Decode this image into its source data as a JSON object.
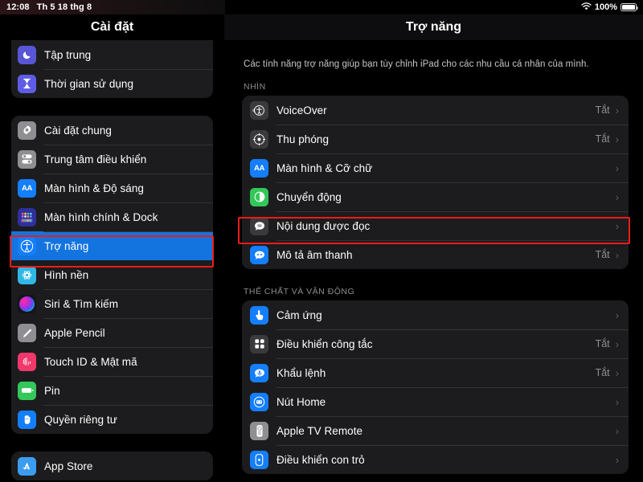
{
  "status_bar": {
    "time": "12:08",
    "date": "Th 5 18 thg 8",
    "wifi_icon": "wifi-icon",
    "battery_percent": "100%",
    "battery_icon": "battery-full-icon"
  },
  "sidebar": {
    "title": "Cài đặt",
    "groups": [
      {
        "items": [
          {
            "label": "Tập trung",
            "icon": "moon-icon",
            "color": "#5856d6"
          },
          {
            "label": "Thời gian sử dụng",
            "icon": "hourglass-icon",
            "color": "#5e5ce6"
          }
        ]
      },
      {
        "items": [
          {
            "label": "Cài đặt chung",
            "icon": "gear-icon",
            "color": "#8e8e93"
          },
          {
            "label": "Trung tâm điều khiển",
            "icon": "toggles-icon",
            "color": "#8e8e93"
          },
          {
            "label": "Màn hình & Độ sáng",
            "icon": "aa-icon",
            "color": "#147efb"
          },
          {
            "label": "Màn hình chính & Dock",
            "icon": "home-grid-icon",
            "color": "#3b3bb5"
          },
          {
            "label": "Trợ năng",
            "icon": "accessibility-icon",
            "color": "#147efb",
            "selected": true
          },
          {
            "label": "Hình nền",
            "icon": "wallpaper-icon",
            "color": "#2fb8e6"
          },
          {
            "label": "Siri & Tìm kiếm",
            "icon": "siri-icon",
            "color": "#1c1c1e"
          },
          {
            "label": "Apple Pencil",
            "icon": "pencil-icon",
            "color": "#8e8e93"
          },
          {
            "label": "Touch ID & Mật mã",
            "icon": "fingerprint-icon",
            "color": "#f0386b"
          },
          {
            "label": "Pin",
            "icon": "battery-icon",
            "color": "#34c759"
          },
          {
            "label": "Quyền riêng tư",
            "icon": "hand-icon",
            "color": "#147efb"
          }
        ]
      },
      {
        "items": [
          {
            "label": "App Store",
            "icon": "appstore-icon",
            "color": "#3b9cf0"
          }
        ]
      }
    ]
  },
  "detail": {
    "title": "Trợ năng",
    "intro": "Các tính năng trợ năng giúp bạn tùy chỉnh iPad cho các nhu cầu cá nhân của mình.",
    "sections": [
      {
        "header": "NHÌN",
        "rows": [
          {
            "label": "VoiceOver",
            "icon": "voiceover-icon",
            "color": "#3a3a3c",
            "value": "Tắt",
            "chevron": "›"
          },
          {
            "label": "Thu phóng",
            "icon": "zoom-icon",
            "color": "#3a3a3c",
            "value": "Tắt",
            "chevron": "›"
          },
          {
            "label": "Màn hình & Cỡ chữ",
            "icon": "aa-icon",
            "color": "#147efb",
            "value": "",
            "chevron": "›"
          },
          {
            "label": "Chuyển động",
            "icon": "motion-icon",
            "color": "#34c759",
            "value": "",
            "chevron": "›"
          },
          {
            "label": "Nội dung được đọc",
            "icon": "spoken-content-icon",
            "color": "#3a3a3c",
            "value": "",
            "chevron": "›",
            "highlighted": true
          },
          {
            "label": "Mô tả âm thanh",
            "icon": "audio-description-icon",
            "color": "#147efb",
            "value": "Tắt",
            "chevron": "›"
          }
        ]
      },
      {
        "header": "THỂ CHẤT VÀ VẬN ĐỘNG",
        "rows": [
          {
            "label": "Cảm ứng",
            "icon": "touch-icon",
            "color": "#147efb",
            "value": "",
            "chevron": "›"
          },
          {
            "label": "Điều khiển công tắc",
            "icon": "switch-control-icon",
            "color": "#3a3a3c",
            "value": "Tắt",
            "chevron": "›"
          },
          {
            "label": "Khẩu lệnh",
            "icon": "voice-control-icon",
            "color": "#147efb",
            "value": "Tắt",
            "chevron": "›"
          },
          {
            "label": "Nút Home",
            "icon": "home-button-icon",
            "color": "#147efb",
            "value": "",
            "chevron": "›"
          },
          {
            "label": "Apple TV Remote",
            "icon": "apple-tv-remote-icon",
            "color": "#8e8e93",
            "value": "",
            "chevron": "›"
          },
          {
            "label": "Điều khiển con trỏ",
            "icon": "pointer-control-icon",
            "color": "#147efb",
            "value": "",
            "chevron": "›"
          }
        ]
      }
    ]
  },
  "annotations": {
    "accent_color": "#ee1b18",
    "selection_color": "#1374e0",
    "boxes": [
      {
        "name": "sidebar-tro-nang-highlight"
      },
      {
        "name": "detail-noi-dung-duoc-doc-highlight"
      }
    ]
  }
}
